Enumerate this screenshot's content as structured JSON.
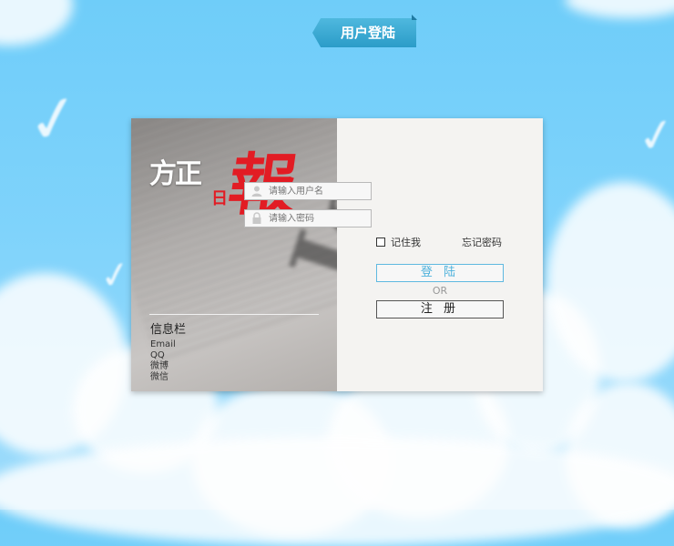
{
  "brand": {
    "logo_part1": "方正",
    "logo_part2": "日",
    "logo_part3": "報"
  },
  "info": {
    "title": "信息栏",
    "links": [
      "Email",
      "QQ",
      "微博",
      "微信"
    ]
  },
  "login": {
    "ribbon_title": "用户登陆",
    "username_placeholder": "请输入用户名",
    "password_placeholder": "请输入密码",
    "remember_label": "记住我",
    "forgot_label": "忘记密码",
    "login_button": "登 陆",
    "or_text": "OR",
    "register_button": "注 册"
  },
  "colors": {
    "sky": "#7fd3fb",
    "accent_blue": "#4fb2dc",
    "logo_red": "#e21c24"
  }
}
